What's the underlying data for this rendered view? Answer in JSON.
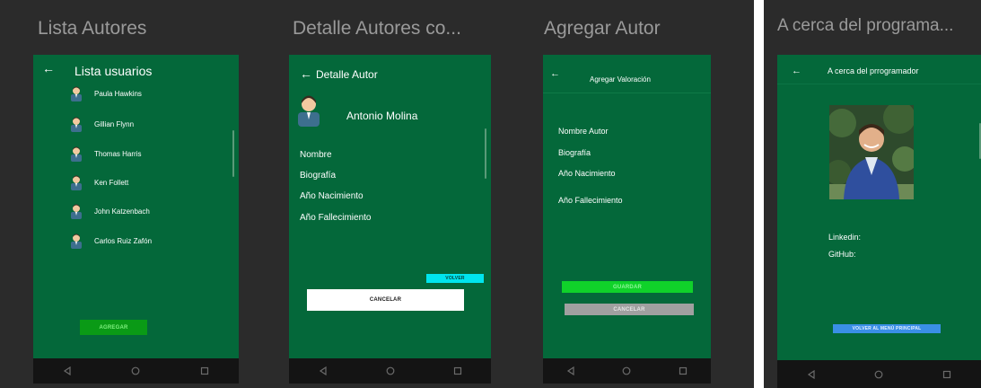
{
  "frames": {
    "lista": {
      "title": "Lista Autores"
    },
    "detalle": {
      "title": "Detalle Autores co..."
    },
    "agregar": {
      "title": "Agregar Autor"
    },
    "acerca": {
      "title": "A cerca del programa..."
    }
  },
  "lista": {
    "back_icon": "arrow-left-icon",
    "title": "Lista usuarios",
    "users": [
      {
        "name": "Paula Hawkins"
      },
      {
        "name": "Gillian Flynn"
      },
      {
        "name": "Thomas Harris"
      },
      {
        "name": "Ken Follett"
      },
      {
        "name": "John Katzenbach"
      },
      {
        "name": "Carlos Ruiz Zafón"
      }
    ],
    "add_button": "AGREGAR"
  },
  "detalle": {
    "title": "Detalle Autor",
    "author_name": "Antonio Molina",
    "fields": [
      "Nombre",
      "Biografía",
      "Año Nacimiento",
      "Año Fallecimiento"
    ],
    "volver_button": "VOLVER",
    "cancelar_button": "CANCELAR"
  },
  "agregar": {
    "title": "Agregar Valoración",
    "fields": [
      "Nombre Autor",
      "Biografía",
      "Año Nacimiento",
      "Año Fallecimiento"
    ],
    "guardar_button": "GUARDAR",
    "cancelar_button": "CANCELAR"
  },
  "acerca": {
    "title": "A cerca del prrogramador",
    "linkedin_label": "Linkedin:",
    "github_label": "GitHub:",
    "menu_button": "VOLVER AL MENÚ PRINCIPAL"
  },
  "colors": {
    "app_background": "#04683a",
    "canvas_background": "#2b2b2b",
    "nav_bar": "#141414",
    "add_button": "#0a9a16",
    "volver_button": "#00e5ee",
    "guardar_button": "#10d22a",
    "cancelar_gray": "#a0a0a0",
    "menu_button": "#3a8fe6"
  },
  "nav_icons": [
    "back-triangle-icon",
    "home-circle-icon",
    "recents-square-icon"
  ]
}
